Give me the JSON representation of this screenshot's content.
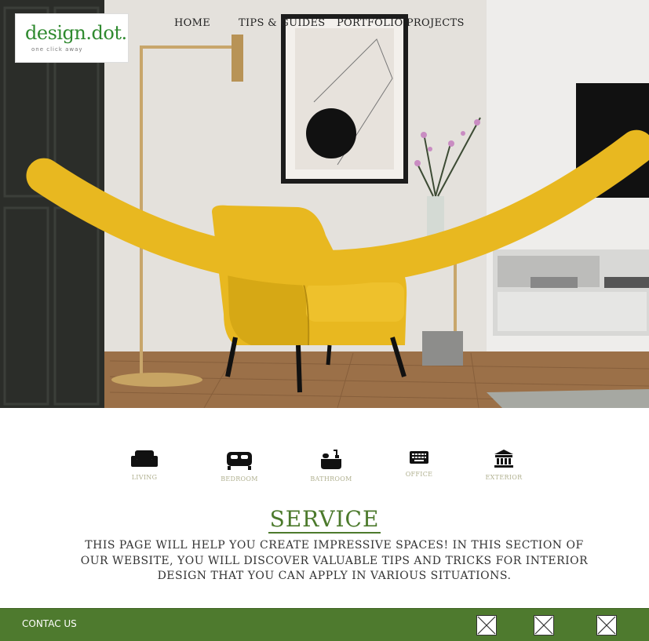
{
  "logo": {
    "name": "design.dot.",
    "tagline": "one click away"
  },
  "nav": {
    "home": "HOME",
    "tips": "TIPS & GUIDES",
    "portfolio": "PORTFOLIO PROJECTS"
  },
  "categories": [
    {
      "label": "LIVING",
      "icon": "sofa-icon"
    },
    {
      "label": "BEDROOM",
      "icon": "bed-icon"
    },
    {
      "label": "BATHROOM",
      "icon": "bathtub-icon"
    },
    {
      "label": "OFFICE",
      "icon": "keyboard-icon"
    },
    {
      "label": "EXTERIOR",
      "icon": "building-icon"
    }
  ],
  "service": {
    "title": "SERVICE",
    "text": "THIS PAGE WILL HELP YOU CREATE IMPRESSIVE SPACES! IN THIS SECTION OF OUR WEBSITE, YOU WILL DISCOVER VALUABLE TIPS AND TRICKS FOR INTERIOR DESIGN THAT YOU CAN APPLY IN VARIOUS SITUATIONS."
  },
  "footer": {
    "contact": "CONTAC US"
  },
  "colors": {
    "brand_green": "#4e7a2e",
    "logo_green": "#2f8a2f",
    "accent_yellow": "#e8b820"
  }
}
